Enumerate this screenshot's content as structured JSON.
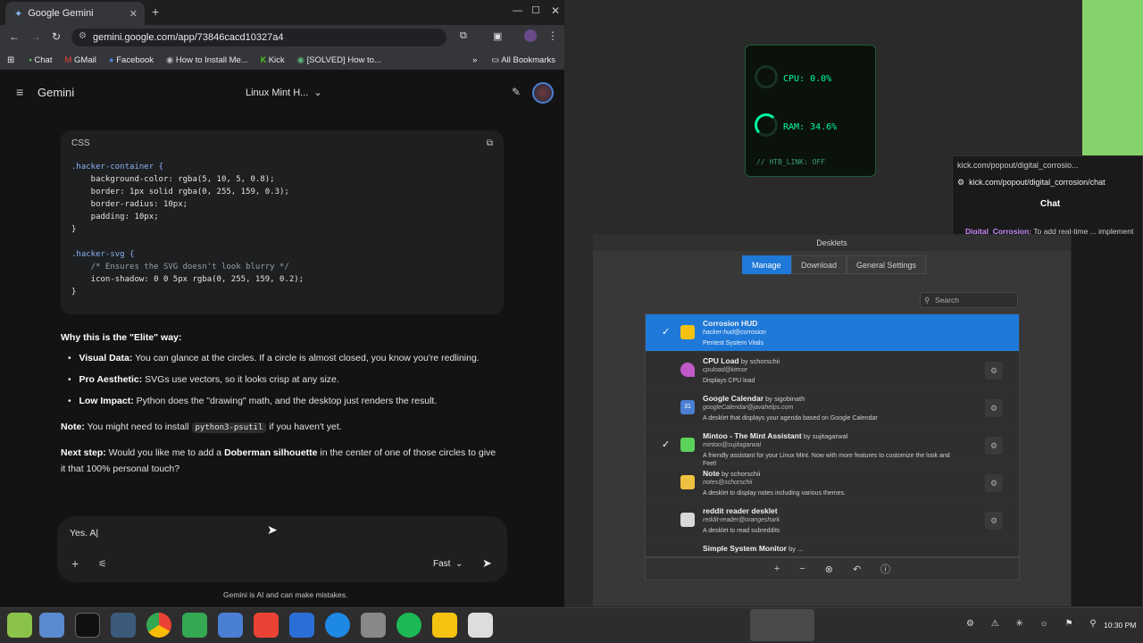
{
  "browser": {
    "tab_title": "Google Gemini",
    "url": "gemini.google.com/app/73846cacd10327a4",
    "bookmarks": [
      "Chat",
      "GMail",
      "Facebook",
      "How to Install Me...",
      "Kick",
      "[SOLVED] How to...",
      "All Bookmarks"
    ]
  },
  "gemini": {
    "app_name": "Gemini",
    "chat_title": "Linux Mint H...",
    "code_lang": "CSS",
    "code_lines": [
      ".hacker-container {",
      "    background-color: rgba(5, 10, 5, 0.8);",
      "    border: 1px solid rgba(0, 255, 159, 0.3);",
      "    border-radius: 10px;",
      "    padding: 10px;",
      "}",
      "",
      ".hacker-svg {",
      "    /* Ensures the SVG doesn't look blurry */",
      "    icon-shadow: 0 0 5px rgba(0, 255, 159, 0.2);",
      "}"
    ],
    "heading": "Why this is the \"Elite\" way:",
    "bullets": [
      {
        "b": "Visual Data:",
        "t": " You can glance at the circles. If a circle is almost closed, you know you're redlining."
      },
      {
        "b": "Pro Aesthetic:",
        "t": " SVGs use vectors, so it looks crisp at any size."
      },
      {
        "b": "Low Impact:",
        "t": " Python does the \"drawing\" math, and the desktop just renders the result."
      }
    ],
    "note_label": "Note:",
    "note_text": " You might need to install ",
    "note_code": "python3-psutil",
    "note_tail": " if you haven't yet.",
    "next_label": "Next step:",
    "next_text": " Would you like me to add a ",
    "next_bold": "Doberman silhouette",
    "next_tail": " in the center of one of those circles to give it that 100% personal touch?",
    "input_value": "Yes. A|",
    "model": "Fast",
    "disclaimer": "Gemini is AI and can make mistakes."
  },
  "hud": {
    "cpu": "CPU: 0.0%",
    "ram": "RAM: 34.6%",
    "link": "// HTB_LINK: OFF",
    "cpu_level": 0.0,
    "ram_level": 0.346
  },
  "desklets": {
    "title": "Desklets",
    "tabs": [
      "Manage",
      "Download",
      "General Settings"
    ],
    "search_placeholder": "Search",
    "items": [
      {
        "name": "Corrosion HUD",
        "by": "",
        "uuid": "hacker-hud@corrosion",
        "desc": "Pentest System Vitals",
        "checked": true,
        "selected": true,
        "color": "#f5c211"
      },
      {
        "name": "CPU Load",
        "by": " by schorschii",
        "uuid": "cpuload@kimse",
        "desc": "Displays CPU load",
        "checked": false,
        "selected": false,
        "color": "#c05ac8"
      },
      {
        "name": "Google Calendar",
        "by": " by sigobinath",
        "uuid": "googleCalendar@javahelps.com",
        "desc": "A desklet that displays your agenda based on Google Calendar",
        "checked": false,
        "selected": false,
        "color": "#4a7fd4"
      },
      {
        "name": "Mintoo - The Mint Assistant",
        "by": " by sujitagarwal",
        "uuid": "mintoo@sujitagarwal",
        "desc": "A friendly assistant for your Linux Mint. Now with more features to customize the look and Feel!",
        "checked": true,
        "selected": false,
        "color": "#5bd25b"
      },
      {
        "name": "Note",
        "by": " by schorschii",
        "uuid": "notes@schorschii",
        "desc": "A desklet to display notes including various themes.",
        "checked": false,
        "selected": false,
        "color": "#f0c040"
      },
      {
        "name": "reddit reader desklet",
        "by": "",
        "uuid": "reddit-reader@orangeshark",
        "desc": "A desklet to read subreddits",
        "checked": false,
        "selected": false,
        "color": "#d8d8d8"
      },
      {
        "name": "Simple System Monitor",
        "by": " by ...",
        "uuid": "",
        "desc": "",
        "checked": false,
        "selected": false,
        "color": "#888"
      }
    ]
  },
  "kick": {
    "title": "kick.com/popout/digital_corrosio...",
    "url": "kick.com/popout/digital_corrosion/chat",
    "header": "Chat",
    "user": "Digital_Corrosion:",
    "msg": " To add real-time ... implement a ... on script. This"
  },
  "taskbar": {
    "time": "10:30 PM"
  }
}
